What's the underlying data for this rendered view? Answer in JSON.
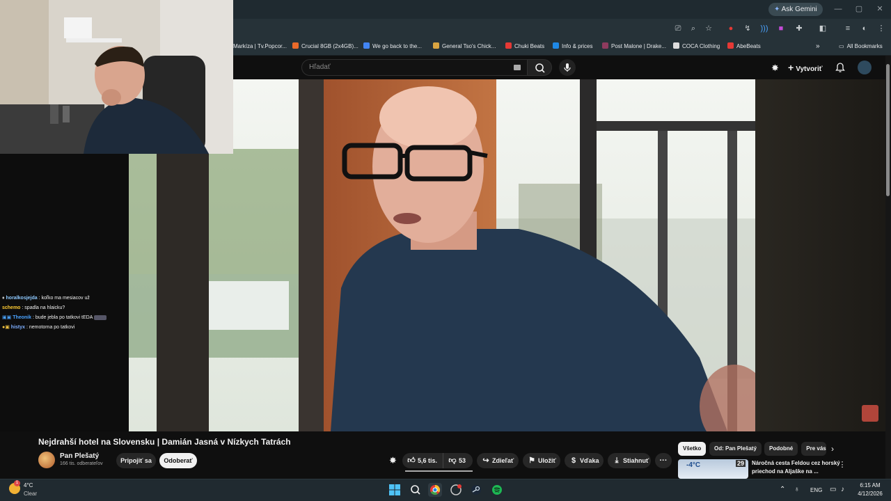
{
  "browser": {
    "ask_gemini": "Ask Gemini",
    "bookmarks": [
      {
        "label": "Markíza | Tv.Popcor...",
        "color": "#7a5cff"
      },
      {
        "label": "Crucial 8GB (2x4GB)...",
        "color": "#ea6a2a"
      },
      {
        "label": "We go back to the...",
        "color": "#4285f4"
      },
      {
        "label": "General Tso's Chick...",
        "color": "#d9a441"
      },
      {
        "label": "Chuki Beats",
        "color": "#e53935"
      },
      {
        "label": "Info & prices",
        "color": "#1e88e5"
      },
      {
        "label": "Post Malone | Drake...",
        "color": "#8e3b5e"
      },
      {
        "label": "COCA Clothing",
        "color": "#333333"
      },
      {
        "label": "AbeBeats",
        "color": "#e53935"
      }
    ],
    "all_bookmarks": "All Bookmarks"
  },
  "youtube": {
    "search_placeholder": "Hľadať",
    "create_label": "Vytvoriť"
  },
  "chat": {
    "messages": [
      {
        "user": "horalkosjejda",
        "text": ": koľko ma mesiacov už",
        "color": "#8ec9ff"
      },
      {
        "user": "schemo",
        "text": ": spadla na hlaicku?",
        "color": "#ffcc33"
      },
      {
        "user": "Theonik",
        "text": ": bude jebla po tatkovi tEDA",
        "color": "#4aa3ff"
      },
      {
        "user": "histyx",
        "text": ": nemotorna po tatkovi",
        "color": "#7fb0ff"
      }
    ]
  },
  "video": {
    "title": "Nejdrahší hotel na Slovensku | Damián Jasná v Nízkych Tatrách",
    "channel": "Pan Plešatý",
    "subscribers": "166 tis. odberateľov",
    "join_label": "Pripojiť sa",
    "subscribe_label": "Odoberať",
    "likes": "5,6 tis.",
    "dislikes": "53",
    "share_label": "Zdieľať",
    "save_label": "Uložiť",
    "thanks_label": "Vďaka",
    "download_label": "Stiahnuť"
  },
  "related": {
    "chips": [
      "Všetko",
      "Od: Pan Plešatý",
      "Podobné",
      "Pre vás"
    ],
    "item": {
      "title": "Náročná cesta Feldou cez horský priechod na Aljaške na ...",
      "thumb_text": "-4°C",
      "thumb_number": "29"
    }
  },
  "taskbar": {
    "weather_temp": "4°C",
    "weather_condition": "Clear",
    "language": "ENG",
    "time": "6:15 AM",
    "date": "4/12/2026"
  }
}
